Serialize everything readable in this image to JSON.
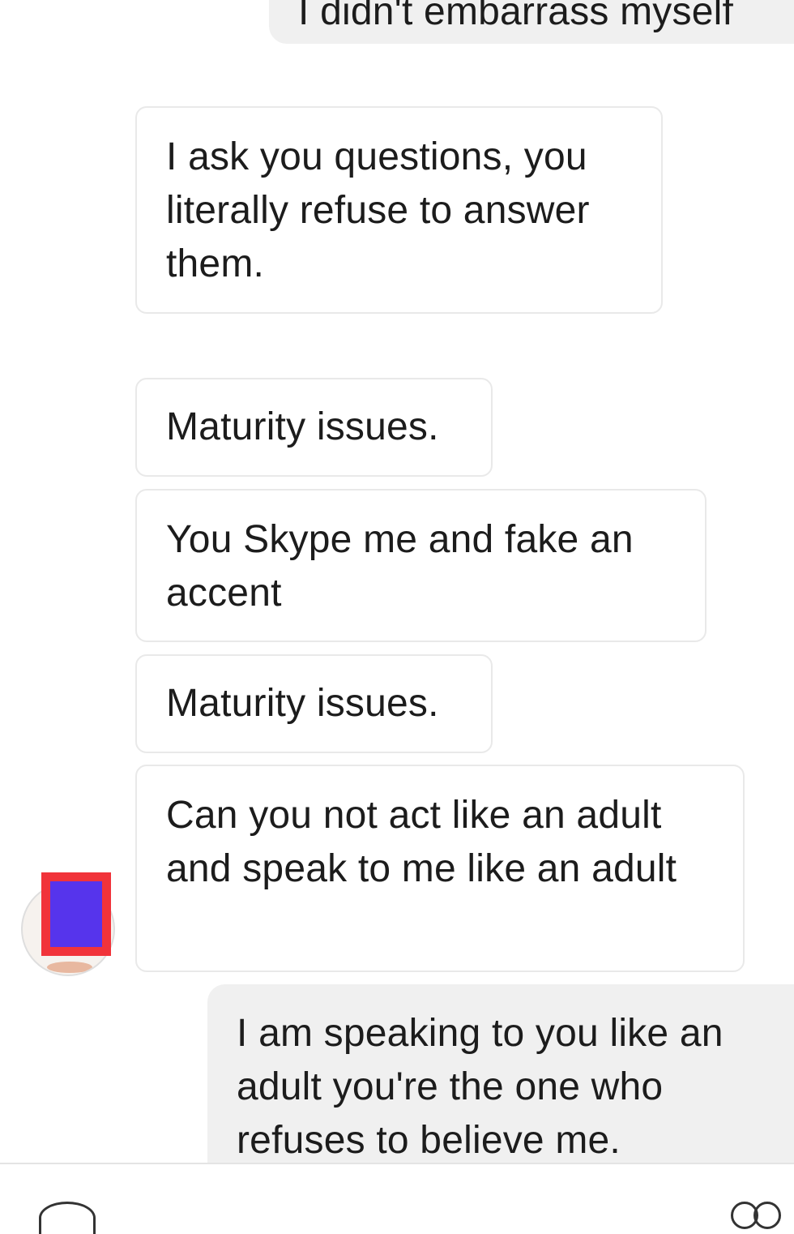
{
  "messages": [
    {
      "direction": "outgoing",
      "text": "I didn't embarrass myself"
    },
    {
      "direction": "incoming",
      "text": "I ask you questions, you literally refuse to answer them."
    },
    {
      "direction": "incoming",
      "text": "Maturity issues."
    },
    {
      "direction": "incoming",
      "text": "You Skype me and fake an accent"
    },
    {
      "direction": "incoming",
      "text": "Maturity issues."
    },
    {
      "direction": "incoming",
      "text": "Can you not act like an adult and speak to me like an adult"
    },
    {
      "direction": "outgoing",
      "text": "I am speaking to you like an adult you're the one who refuses to believe me."
    }
  ],
  "colors": {
    "incoming_bg": "#ffffff",
    "incoming_border": "#e9e9e9",
    "outgoing_bg": "#f0f0f0",
    "text": "#1c1c1c",
    "redaction_border": "#f1333a",
    "redaction_fill": "#5634ec"
  },
  "icons": {
    "composer_left": "camera-icon",
    "composer_right": "heart-icon"
  }
}
